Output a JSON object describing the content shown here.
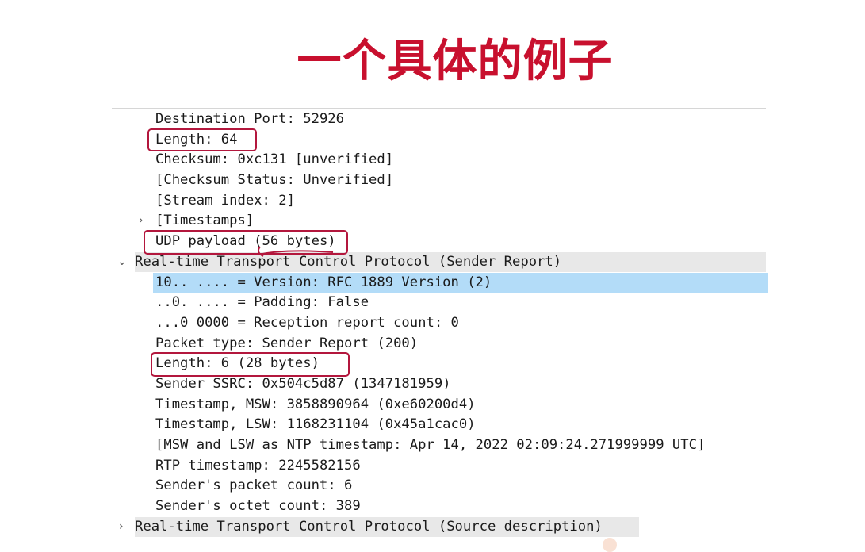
{
  "slide_title": "一个具体的例子",
  "colors": {
    "title": "#c8102e",
    "highlight_box": "#b3173d",
    "selected_row": "#b3dcf8",
    "section_row": "#e8e8e8"
  },
  "packet_details": {
    "udp_fields": [
      "Destination Port: 52926",
      "Length: 64",
      "Checksum: 0xc131 [unverified]",
      "[Checksum Status: Unverified]",
      "[Stream index: 2]",
      "[Timestamps]",
      "UDP payload (56 bytes)"
    ],
    "rtcp_sender_report": {
      "header": "Real-time Transport Control Protocol (Sender Report)",
      "fields": [
        "10.. .... = Version: RFC 1889 Version (2)",
        "..0. .... = Padding: False",
        "...0 0000 = Reception report count: 0",
        "Packet type: Sender Report (200)",
        "Length: 6 (28 bytes)",
        "Sender SSRC: 0x504c5d87 (1347181959)",
        "Timestamp, MSW: 3858890964 (0xe60200d4)",
        "Timestamp, LSW: 1168231104 (0x45a1cac0)",
        "[MSW and LSW as NTP timestamp: Apr 14, 2022 02:09:24.271999999 UTC]",
        "RTP timestamp: 2245582156",
        "Sender's packet count: 6",
        "Sender's octet count: 389"
      ]
    },
    "rtcp_source_description": {
      "header": "Real-time Transport Control Protocol (Source description)"
    }
  },
  "icons": {
    "collapsed": "chevron-right-icon",
    "expanded": "chevron-down-icon"
  }
}
